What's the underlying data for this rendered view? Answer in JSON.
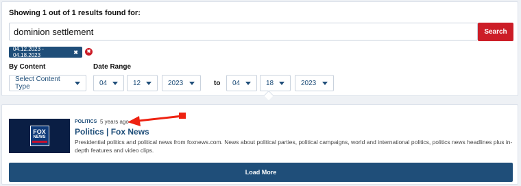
{
  "search": {
    "heading": "Showing 1 out of 1 results found for:",
    "query": "dominion settlement",
    "button_label": "Search"
  },
  "active_filter": {
    "label": "04.12.2023 - 04.18.2023",
    "remove_glyph": "✖",
    "clear_glyph": "✖"
  },
  "filters": {
    "content_label": "By Content",
    "content_select": "Select Content Type",
    "date_label": "Date Range",
    "from": {
      "month": "04",
      "day": "12",
      "year": "2023"
    },
    "to_label": "to",
    "to": {
      "month": "04",
      "day": "18",
      "year": "2023"
    }
  },
  "result": {
    "category": "POLITICS",
    "age": "5 years ago",
    "title": "Politics | Fox News",
    "description": "Presidential politics and political news from foxnews.com. News about political parties, political campaigns, world and international politics, politics news headlines plus in-depth features and video clips.",
    "thumbnail": {
      "line1": "FOX",
      "line2": "NEWS"
    }
  },
  "load_more_label": "Load More",
  "colors": {
    "accent_blue": "#1f4e79",
    "accent_red": "#cc1d27",
    "annotation_red": "#ee2211"
  }
}
